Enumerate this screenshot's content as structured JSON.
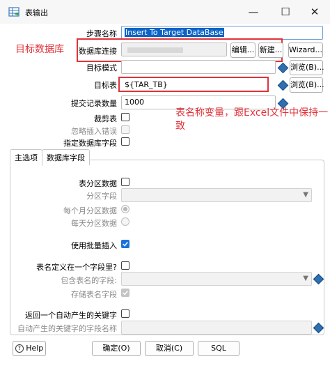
{
  "window": {
    "title": "表输出",
    "minimize_glyph": "—",
    "maximize_glyph": "☐",
    "close_glyph": "✕"
  },
  "annotations": {
    "db_label": "目标数据库",
    "table_var_line1": "表名称变量，跟Excel文件中保持一",
    "table_var_line2": "致"
  },
  "form": {
    "step_name_label": "步骤名称",
    "step_name_value": "Insert To Target DataBase",
    "db_conn_label": "数据库连接",
    "db_conn_value": "",
    "edit_button": "编辑...",
    "new_button": "新建...",
    "wizard_button": "Wizard...",
    "target_schema_label": "目标模式",
    "target_schema_value": "",
    "browse_button": "浏览(B)...",
    "target_table_label": "目标表",
    "target_table_value": "${TAR_TB}",
    "commit_size_label": "提交记录数量",
    "commit_size_value": "1000",
    "truncate_label": "裁剪表",
    "ignore_errors_label": "忽略插入错误",
    "specify_fields_label": "指定数据库字段"
  },
  "tabs": [
    "主选项",
    "数据库字段"
  ],
  "main_options": {
    "partition_label": "表分区数据",
    "partition_field_label": "分区字段",
    "monthly_label": "每个月分区数据",
    "daily_label": "每天分区数据",
    "batch_insert_label": "使用批量插入",
    "name_in_field_label": "表名定义在一个字段里?",
    "name_field_label": "包含表名的字段:",
    "store_name_label": "存储表名字段",
    "return_key_label": "返回一个自动产生的关键字",
    "key_field_label": "自动产生的关键字的字段名称"
  },
  "footer": {
    "help_label": "Help",
    "ok_label": "确定(O)",
    "cancel_label": "取消(C)",
    "sql_label": "SQL"
  },
  "colors": {
    "annotation_red": "#e0323a",
    "accent_blue": "#1a73d9",
    "selection_blue": "#0b63c5"
  }
}
